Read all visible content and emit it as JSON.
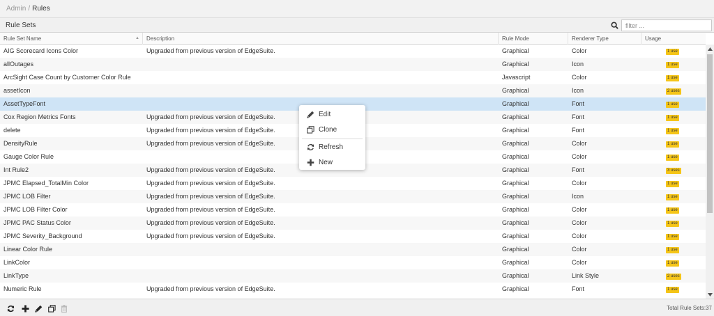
{
  "breadcrumb": {
    "parent": "Admin",
    "separator": "/",
    "current": "Rules"
  },
  "panel": {
    "title": "Rule Sets"
  },
  "search": {
    "placeholder": "filter ..."
  },
  "columns": [
    "Rule Set Name",
    "Description",
    "Rule Mode",
    "Renderer Type",
    "Usage"
  ],
  "sort": {
    "column": "Rule Set Name",
    "direction": "asc"
  },
  "rows": [
    {
      "name": "AIG Scorecard Icons Color",
      "description": "Upgraded from previous version of EdgeSuite.",
      "mode": "Graphical",
      "renderer": "Color",
      "usage": "1 use"
    },
    {
      "name": "allOutages",
      "description": "",
      "mode": "Graphical",
      "renderer": "Icon",
      "usage": "1 use"
    },
    {
      "name": "ArcSight Case Count by Customer Color Rule",
      "description": "",
      "mode": "Javascript",
      "renderer": "Color",
      "usage": "1 use"
    },
    {
      "name": "assetIcon",
      "description": "",
      "mode": "Graphical",
      "renderer": "Icon",
      "usage": "2 uses"
    },
    {
      "name": "AssetTypeFont",
      "description": "",
      "mode": "Graphical",
      "renderer": "Font",
      "usage": "1 use"
    },
    {
      "name": "Cox Region Metrics Fonts",
      "description": "Upgraded from previous version of EdgeSuite.",
      "mode": "Graphical",
      "renderer": "Font",
      "usage": "1 use"
    },
    {
      "name": "delete",
      "description": "Upgraded from previous version of EdgeSuite.",
      "mode": "Graphical",
      "renderer": "Font",
      "usage": "1 use"
    },
    {
      "name": "DensityRule",
      "description": "Upgraded from previous version of EdgeSuite.",
      "mode": "Graphical",
      "renderer": "Color",
      "usage": "1 use"
    },
    {
      "name": "Gauge Color Rule",
      "description": "",
      "mode": "Graphical",
      "renderer": "Color",
      "usage": "1 use"
    },
    {
      "name": "Int Rule2",
      "description": "Upgraded from previous version of EdgeSuite.",
      "mode": "Graphical",
      "renderer": "Font",
      "usage": "3 uses"
    },
    {
      "name": "JPMC Elapsed_TotalMin Color",
      "description": "Upgraded from previous version of EdgeSuite.",
      "mode": "Graphical",
      "renderer": "Color",
      "usage": "1 use"
    },
    {
      "name": "JPMC LOB Filter",
      "description": "Upgraded from previous version of EdgeSuite.",
      "mode": "Graphical",
      "renderer": "Icon",
      "usage": "1 use"
    },
    {
      "name": "JPMC LOB Filter Color",
      "description": "Upgraded from previous version of EdgeSuite.",
      "mode": "Graphical",
      "renderer": "Color",
      "usage": "1 use"
    },
    {
      "name": "JPMC PAC Status Color",
      "description": "Upgraded from previous version of EdgeSuite.",
      "mode": "Graphical",
      "renderer": "Color",
      "usage": "1 use"
    },
    {
      "name": "JPMC Severity_Background",
      "description": "Upgraded from previous version of EdgeSuite.",
      "mode": "Graphical",
      "renderer": "Color",
      "usage": "1 use"
    },
    {
      "name": "Linear Color Rule",
      "description": "",
      "mode": "Graphical",
      "renderer": "Color",
      "usage": "1 use"
    },
    {
      "name": "LinkColor",
      "description": "",
      "mode": "Graphical",
      "renderer": "Color",
      "usage": "1 use"
    },
    {
      "name": "LinkType",
      "description": "",
      "mode": "Graphical",
      "renderer": "Link Style",
      "usage": "2 uses"
    },
    {
      "name": "Numeric Rule",
      "description": "Upgraded from previous version of EdgeSuite.",
      "mode": "Graphical",
      "renderer": "Font",
      "usage": "1 use"
    }
  ],
  "selected_row": "AssetTypeFont",
  "context_menu": {
    "items": [
      {
        "label": "Edit",
        "icon": "pencil-icon"
      },
      {
        "label": "Clone",
        "icon": "clone-icon"
      },
      {
        "label": "Refresh",
        "icon": "refresh-icon"
      },
      {
        "label": "New",
        "icon": "plus-icon"
      }
    ]
  },
  "footer": {
    "buttons": [
      {
        "name": "refresh-button",
        "icon": "refresh-icon",
        "enabled": true
      },
      {
        "name": "add-button",
        "icon": "plus-icon",
        "enabled": true
      },
      {
        "name": "edit-button",
        "icon": "pencil-icon",
        "enabled": true
      },
      {
        "name": "clone-button",
        "icon": "clone-icon",
        "enabled": true
      },
      {
        "name": "delete-button",
        "icon": "trash-icon",
        "enabled": false
      }
    ],
    "total_label": "Total Rule Sets:",
    "total_count": "37"
  },
  "colors": {
    "selected_row": "#cfe4f6",
    "usage_badge": "#f5c518",
    "header_bg": "#f0f0f0"
  }
}
